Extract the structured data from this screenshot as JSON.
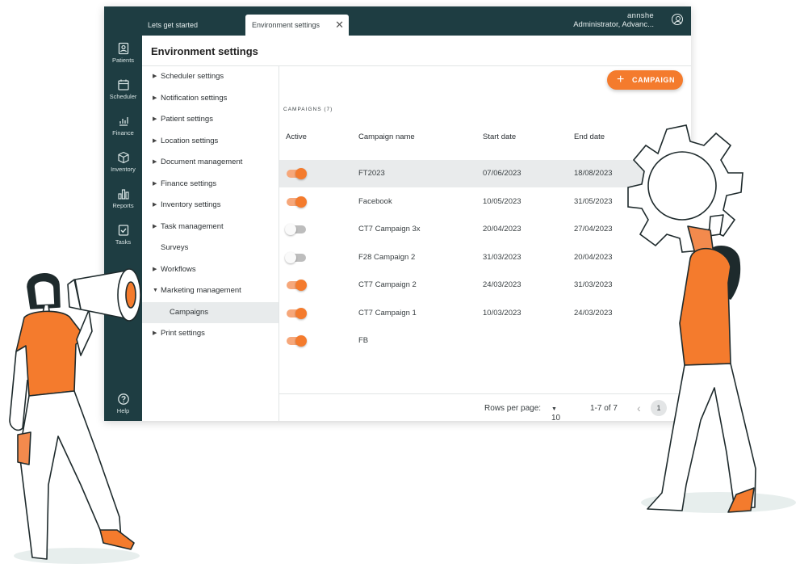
{
  "tabs": [
    {
      "label": "Lets get started"
    },
    {
      "label": "Environment settings"
    }
  ],
  "user": {
    "name": "annshe",
    "role": "Administrator, Advanc..."
  },
  "rail": [
    {
      "label": "Patients",
      "icon": "patients-icon"
    },
    {
      "label": "Scheduler",
      "icon": "calendar-icon"
    },
    {
      "label": "Finance",
      "icon": "finance-icon"
    },
    {
      "label": "Inventory",
      "icon": "box-icon"
    },
    {
      "label": "Reports",
      "icon": "bar-chart-icon"
    },
    {
      "label": "Tasks",
      "icon": "checklist-icon"
    },
    {
      "label": "Help",
      "icon": "help-icon"
    }
  ],
  "page_title": "Environment settings",
  "menu": [
    {
      "label": "Scheduler settings",
      "caret": "▶"
    },
    {
      "label": "Notification settings",
      "caret": "▶"
    },
    {
      "label": "Patient settings",
      "caret": "▶"
    },
    {
      "label": "Location settings",
      "caret": "▶"
    },
    {
      "label": "Document management",
      "caret": "▶"
    },
    {
      "label": "Finance settings",
      "caret": "▶"
    },
    {
      "label": "Inventory settings",
      "caret": "▶"
    },
    {
      "label": "Task management",
      "caret": "▶"
    },
    {
      "label": "Surveys",
      "caret": ""
    },
    {
      "label": "Workflows",
      "caret": "▶"
    },
    {
      "label": "Marketing management",
      "caret": "▼"
    },
    {
      "label": "Campaigns",
      "caret": ""
    },
    {
      "label": "Print settings",
      "caret": "▶"
    }
  ],
  "add_button": {
    "label": "CAMPAIGN",
    "plus": "+"
  },
  "section_label": "CAMPAIGNS (7)",
  "columns": {
    "active": "Active",
    "name": "Campaign name",
    "start": "Start date",
    "end": "End date"
  },
  "rows": [
    {
      "active": true,
      "name": "FT2023",
      "start": "07/06/2023",
      "end": "18/08/2023"
    },
    {
      "active": true,
      "name": "Facebook",
      "start": "10/05/2023",
      "end": "31/05/2023"
    },
    {
      "active": false,
      "name": "CT7 Campaign 3x",
      "start": "20/04/2023",
      "end": "27/04/2023"
    },
    {
      "active": false,
      "name": "F28 Campaign 2",
      "start": "31/03/2023",
      "end": "20/04/2023"
    },
    {
      "active": true,
      "name": "CT7 Campaign 2",
      "start": "24/03/2023",
      "end": "31/03/2023"
    },
    {
      "active": true,
      "name": "CT7 Campaign 1",
      "start": "10/03/2023",
      "end": "24/03/2023"
    },
    {
      "active": true,
      "name": "FB",
      "start": "",
      "end": ""
    }
  ],
  "pagination": {
    "rows_label": "Rows per page:",
    "rows_value": "10",
    "range": "1-7 of 7",
    "page": "1",
    "prev": "‹"
  },
  "colors": {
    "brand_dark": "#1e3d42",
    "accent": "#f47b2d"
  }
}
